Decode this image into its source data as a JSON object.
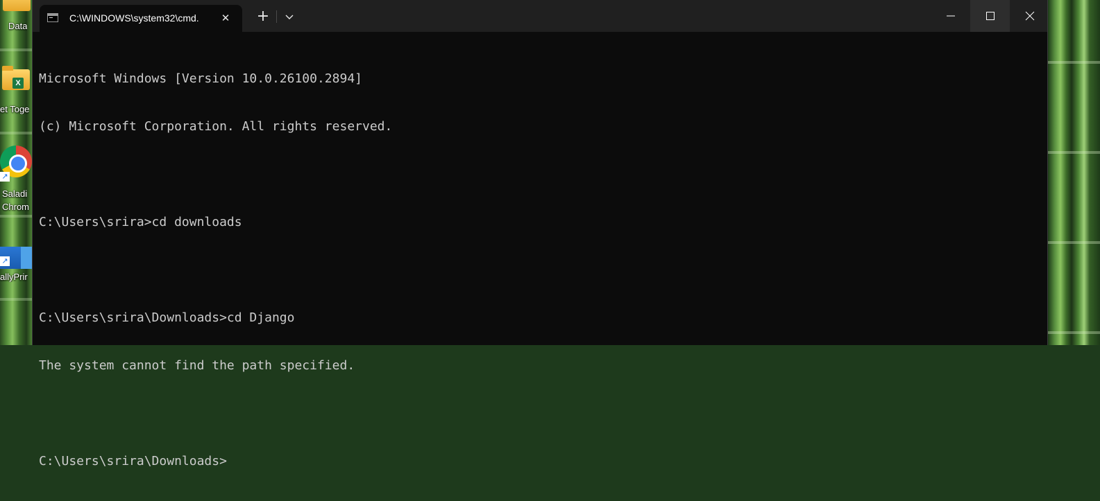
{
  "desktop": {
    "icons": [
      {
        "label": "Data",
        "icon": "folder-icon"
      },
      {
        "label": "et Toge",
        "icon": "excel-folder-icon"
      },
      {
        "label": "Saladi",
        "label2": "Chrom",
        "icon": "chrome-icon"
      },
      {
        "label": "allyPrir",
        "icon": "tallyprime-icon"
      }
    ]
  },
  "window": {
    "tab_title": "C:\\WINDOWS\\system32\\cmd.",
    "tab_close": "✕",
    "new_tab": "+",
    "controls": {
      "minimize": "minimize-icon",
      "maximize": "maximize-icon",
      "close": "close-icon"
    }
  },
  "console": {
    "lines": [
      "Microsoft Windows [Version 10.0.26100.2894]",
      "(c) Microsoft Corporation. All rights reserved.",
      "",
      "C:\\Users\\srira>cd downloads",
      "",
      "C:\\Users\\srira\\Downloads>cd Django",
      "The system cannot find the path specified.",
      "",
      "C:\\Users\\srira\\Downloads>"
    ]
  }
}
